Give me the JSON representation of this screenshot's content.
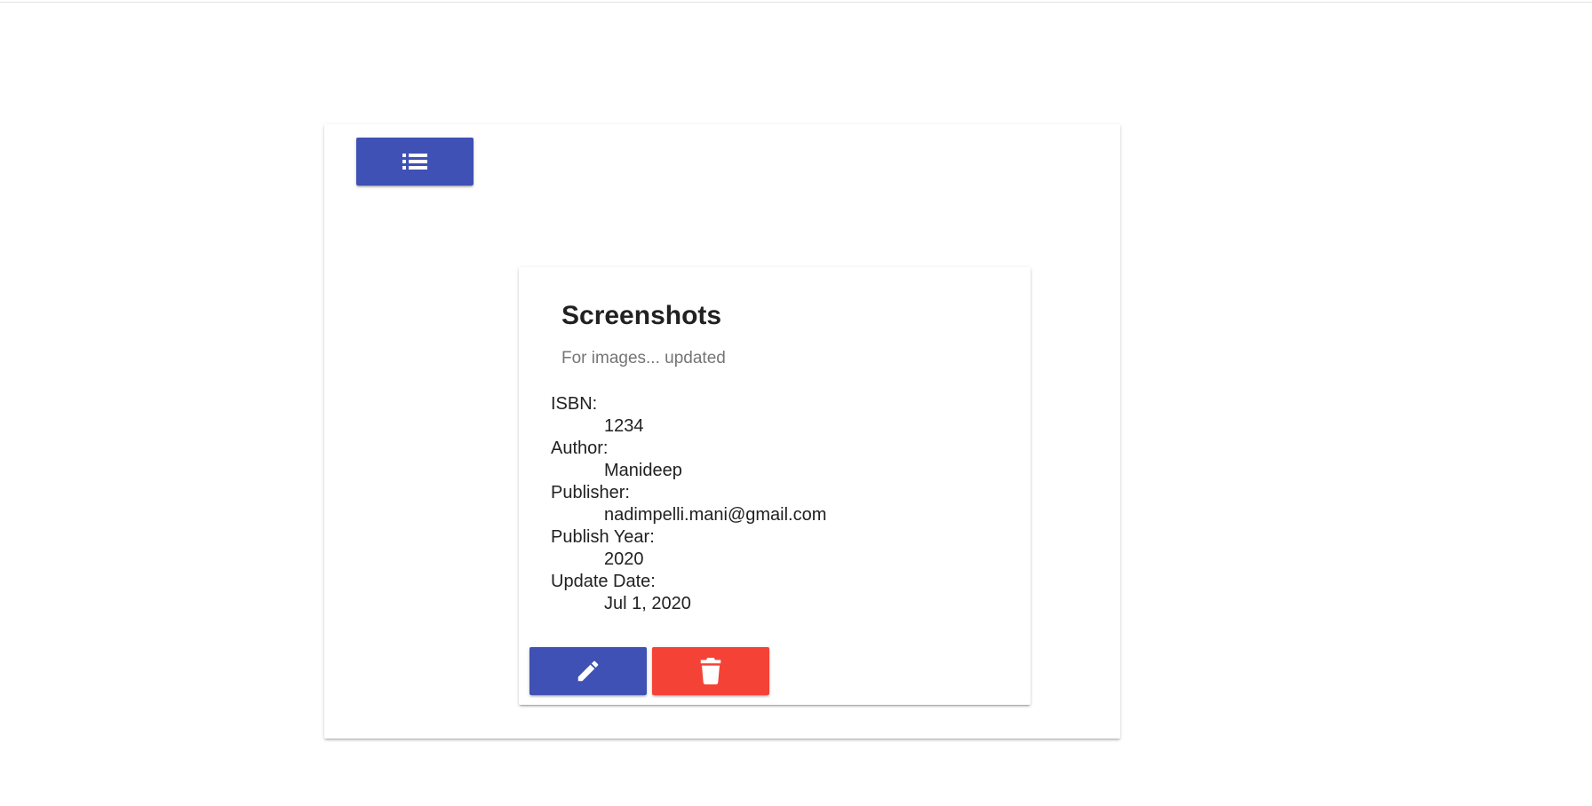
{
  "theme": {
    "primary": "#3f51b5",
    "danger": "#f44336",
    "icon_color": "#ffffff"
  },
  "toolbar": {
    "list_button_icon": "list-icon"
  },
  "book": {
    "title": "Screenshots",
    "subtitle": "For images... updated",
    "fields": [
      {
        "label": "ISBN:",
        "value": "1234"
      },
      {
        "label": "Author:",
        "value": "Manideep"
      },
      {
        "label": "Publisher:",
        "value": "nadimpelli.mani@gmail.com"
      },
      {
        "label": "Publish Year:",
        "value": "2020"
      },
      {
        "label": "Update Date:",
        "value": "Jul 1, 2020"
      }
    ]
  },
  "actions": {
    "edit_icon": "pencil-icon",
    "delete_icon": "trash-icon"
  }
}
